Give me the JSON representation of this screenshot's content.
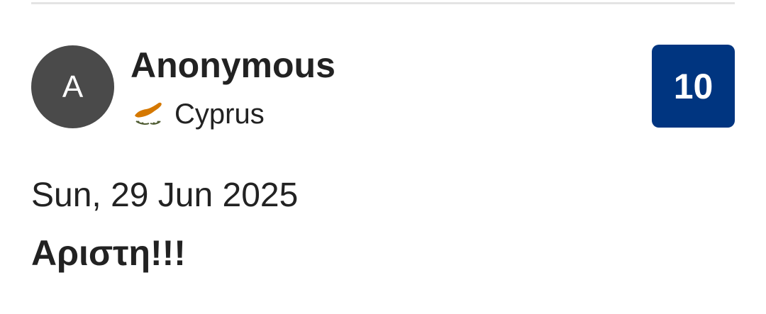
{
  "review": {
    "avatar_letter": "A",
    "reviewer_name": "Anonymous",
    "country_flag_icon": "cyprus-flag-icon",
    "country": "Cyprus",
    "score": "10",
    "date": "Sun, 29 Jun 2025",
    "title": "Αριστη!!!"
  },
  "colors": {
    "score_badge": "#003580",
    "avatar_bg": "#4a4a4a",
    "flag_copper": "#d57800",
    "flag_olive": "#4e5b31"
  }
}
